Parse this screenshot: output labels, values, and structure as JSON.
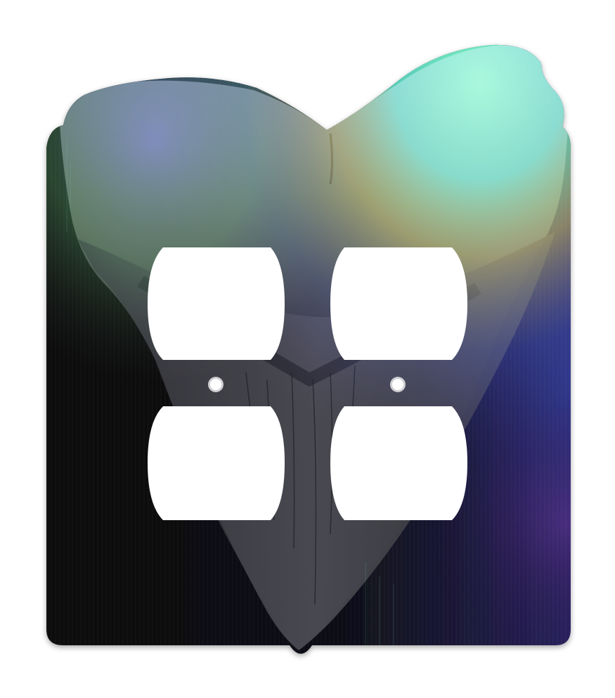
{
  "product": {
    "kind": "double duplex outlet wall plate",
    "shape": "megalodon shark tooth",
    "outlet_openings": 4,
    "screw_holes": 2
  },
  "colors": {
    "background": "#ffffff",
    "plate_dark": "#0b0c12",
    "tooth_body": "#3a3a40",
    "tooth_blade": "#4a4a50",
    "iridescent_green": "#6ef0b8",
    "iridescent_teal": "#5ad6d0",
    "iridescent_yellow": "#e8d36a",
    "iridescent_purple": "#5a3c9a",
    "iridescent_blue": "#2a3a8a",
    "outlet_fill": "#ffffff"
  },
  "icons": {
    "outlet_opening": "duplex-outlet-cutout",
    "screw_hole": "screw-hole"
  }
}
